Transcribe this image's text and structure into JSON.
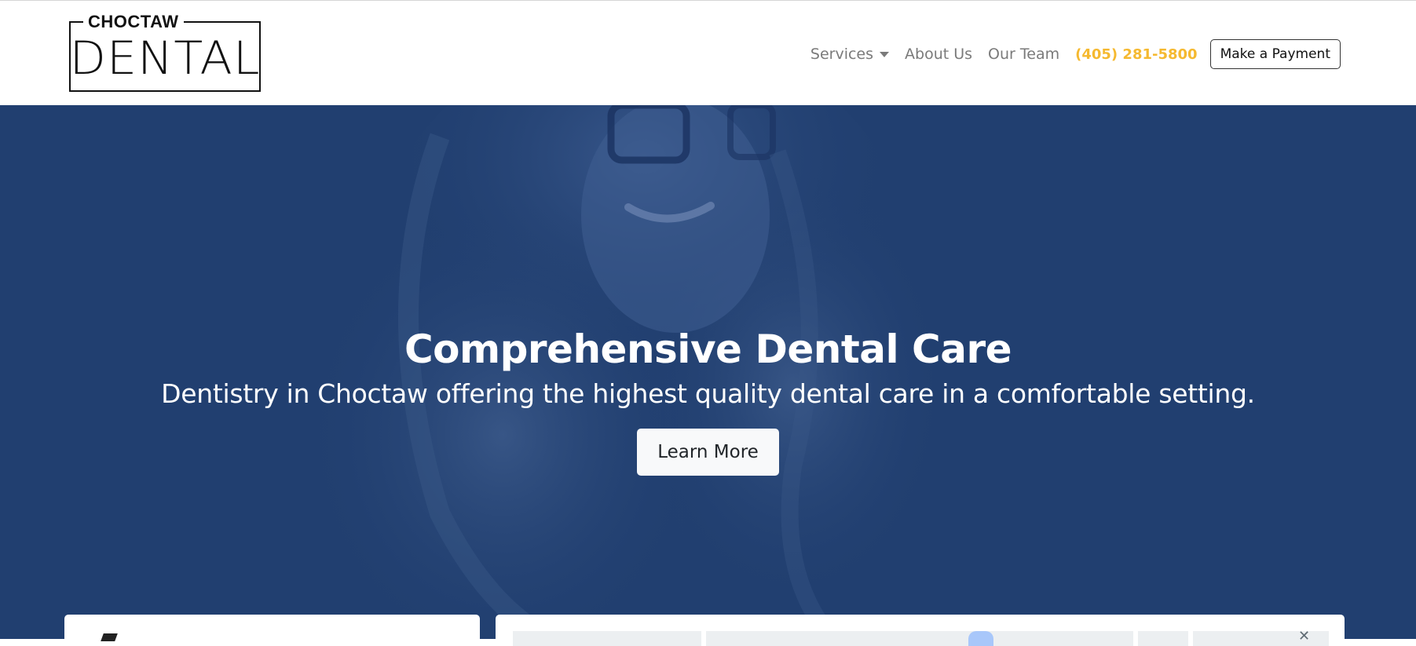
{
  "brand": {
    "logo_top": "CHOCTAW",
    "logo_main": "DENTAL"
  },
  "nav": {
    "services_label": "Services",
    "about_label": "About Us",
    "team_label": "Our Team",
    "phone": "(405) 281-5800",
    "payment_label": "Make a Payment"
  },
  "hero": {
    "title": "Comprehensive Dental Care",
    "subtitle": "Dentistry in Choctaw offering the highest quality dental care in a comfortable setting.",
    "cta_label": "Learn More"
  },
  "colors": {
    "hero_overlay": "#213f70",
    "phone_accent": "#f5b930",
    "nav_text": "#7a7a7a"
  },
  "icons": {
    "services_dropdown": "chevron-down-icon"
  }
}
